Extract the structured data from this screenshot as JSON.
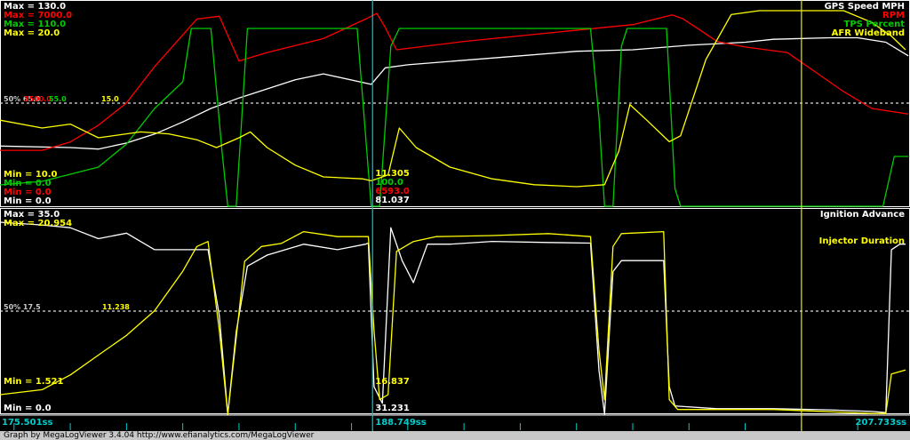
{
  "footer_credit": "Graph by MegaLogViewer 3.4.04 http://www.efianalytics.com/MegaLogViewer",
  "chart_data": [
    {
      "type": "line",
      "panel": "top",
      "max_labels": [
        {
          "text": "Max = 130.0",
          "color": "#ffffff"
        },
        {
          "text": "Max = 7000.0",
          "color": "#ff0000"
        },
        {
          "text": "Max = 110.0",
          "color": "#00cc00"
        },
        {
          "text": "Max = 20.0",
          "color": "#ffff00"
        }
      ],
      "min_labels": [
        {
          "text": "Min = 10.0",
          "color": "#ffff00"
        },
        {
          "text": "Min = 0.0",
          "color": "#00cc00"
        },
        {
          "text": "Min = 0.0",
          "color": "#ff0000"
        },
        {
          "text": "Min = 0.0",
          "color": "#ffffff"
        }
      ],
      "mid_labels": [
        {
          "text": "50%  65.0",
          "color": "#c8c8c8"
        },
        {
          "text": "3500.0",
          "color": "#ff0000"
        },
        {
          "text": "55.0",
          "color": "#00cc00"
        },
        {
          "text": "15.0",
          "color": "#ffff00"
        }
      ],
      "cursor_values": [
        {
          "text": "11.305",
          "color": "#ffff00"
        },
        {
          "text": "100.0",
          "color": "#00cc00"
        },
        {
          "text": "6593.0",
          "color": "#ff0000"
        },
        {
          "text": "81.037",
          "color": "#ffffff"
        }
      ],
      "series": [
        {
          "name": "GPS Speed MPH",
          "color": "#ffffff",
          "min": 0,
          "max": 130,
          "points": [
            [
              175.5,
              40
            ],
            [
              178,
              39
            ],
            [
              179,
              38
            ],
            [
              180,
              42
            ],
            [
              181,
              48
            ],
            [
              182,
              56
            ],
            [
              183,
              65
            ],
            [
              184,
              72
            ],
            [
              185,
              78
            ],
            [
              186,
              84
            ],
            [
              187,
              88
            ],
            [
              188.7,
              81
            ],
            [
              189.2,
              92
            ],
            [
              190,
              94
            ],
            [
              192,
              97
            ],
            [
              194,
              100
            ],
            [
              196,
              103
            ],
            [
              198,
              104
            ],
            [
              200,
              107
            ],
            [
              202,
              109
            ],
            [
              203,
              111
            ],
            [
              205,
              112
            ],
            [
              206,
              112
            ],
            [
              207,
              109
            ],
            [
              207.8,
              100
            ]
          ]
        },
        {
          "name": "RPM",
          "color": "#ff0000",
          "min": 0,
          "max": 7000,
          "points": [
            [
              175.5,
              2000
            ],
            [
              177,
              2000
            ],
            [
              178,
              2300
            ],
            [
              179,
              2900
            ],
            [
              180,
              3700
            ],
            [
              181,
              5000
            ],
            [
              182.5,
              6700
            ],
            [
              183.3,
              6800
            ],
            [
              184,
              5200
            ],
            [
              185,
              5500
            ],
            [
              187,
              6000
            ],
            [
              188.5,
              6700
            ],
            [
              188.9,
              6900
            ],
            [
              189.2,
              6400
            ],
            [
              189.6,
              5600
            ],
            [
              192,
              5900
            ],
            [
              195,
              6200
            ],
            [
              198,
              6500
            ],
            [
              199.4,
              6850
            ],
            [
              199.8,
              6700
            ],
            [
              201,
              5900
            ],
            [
              202,
              5700
            ],
            [
              203.5,
              5500
            ],
            [
              204.5,
              4800
            ],
            [
              205.5,
              4100
            ],
            [
              206.5,
              3500
            ],
            [
              207.8,
              3300
            ]
          ]
        },
        {
          "name": "TPS Percent",
          "color": "#00cc00",
          "min": 0,
          "max": 110,
          "points": [
            [
              175.5,
              12
            ],
            [
              177,
              14
            ],
            [
              178,
              18
            ],
            [
              179,
              22
            ],
            [
              180,
              35
            ],
            [
              181,
              55
            ],
            [
              182,
              70
            ],
            [
              182.3,
              100
            ],
            [
              183,
              100
            ],
            [
              183.4,
              30
            ],
            [
              183.6,
              0
            ],
            [
              183.9,
              0
            ],
            [
              184.3,
              100
            ],
            [
              188.2,
              100
            ],
            [
              188.6,
              20
            ],
            [
              188.7,
              0
            ],
            [
              189,
              0
            ],
            [
              189.4,
              90
            ],
            [
              189.7,
              100
            ],
            [
              196.5,
              100
            ],
            [
              196.8,
              50
            ],
            [
              197,
              0
            ],
            [
              197.3,
              0
            ],
            [
              197.6,
              90
            ],
            [
              197.8,
              100
            ],
            [
              199.2,
              100
            ],
            [
              199.5,
              10
            ],
            [
              199.7,
              0
            ],
            [
              206.9,
              0
            ],
            [
              207.3,
              28
            ],
            [
              207.8,
              28
            ]
          ]
        },
        {
          "name": "AFR Wideband",
          "color": "#ffff00",
          "min": 10,
          "max": 20,
          "points": [
            [
              175.5,
              14.4
            ],
            [
              177,
              14
            ],
            [
              178,
              14.2
            ],
            [
              179,
              13.5
            ],
            [
              180.5,
              13.8
            ],
            [
              181.5,
              13.7
            ],
            [
              182.5,
              13.4
            ],
            [
              183.2,
              13.0
            ],
            [
              184,
              13.5
            ],
            [
              184.4,
              13.8
            ],
            [
              185,
              13.0
            ],
            [
              186,
              12.1
            ],
            [
              187,
              11.5
            ],
            [
              188.4,
              11.4
            ],
            [
              188.7,
              11.3
            ],
            [
              189.3,
              11.6
            ],
            [
              189.7,
              14.0
            ],
            [
              190.3,
              13.0
            ],
            [
              191.5,
              12.0
            ],
            [
              193,
              11.4
            ],
            [
              194.5,
              11.1
            ],
            [
              196,
              11.0
            ],
            [
              197,
              11.1
            ],
            [
              197.5,
              12.8
            ],
            [
              197.9,
              15.2
            ],
            [
              198.5,
              14.4
            ],
            [
              199.3,
              13.3
            ],
            [
              199.7,
              13.6
            ],
            [
              200.6,
              17.5
            ],
            [
              201.5,
              19.8
            ],
            [
              202.5,
              20
            ],
            [
              204,
              20
            ],
            [
              205.5,
              20
            ],
            [
              206.5,
              19.4
            ],
            [
              207.2,
              18.7
            ],
            [
              207.7,
              18.0
            ]
          ]
        }
      ],
      "legend": [
        {
          "text": "GPS Speed MPH",
          "color": "#ffffff"
        },
        {
          "text": "RPM",
          "color": "#ff0000"
        },
        {
          "text": "TPS Percent",
          "color": "#00cc00"
        },
        {
          "text": "AFR Wideband",
          "color": "#ffff00"
        }
      ]
    },
    {
      "type": "line",
      "panel": "bottom",
      "max_labels": [
        {
          "text": "Max = 35.0",
          "color": "#ffffff"
        },
        {
          "text": "Max = 20.954",
          "color": "#ffff00"
        }
      ],
      "min_labels": [
        {
          "text": "Min = 1.521",
          "color": "#ffff00"
        },
        {
          "text": "Min = 0.0",
          "color": "#ffffff"
        }
      ],
      "mid_labels": [
        {
          "text": "50%  17.5",
          "color": "#c8c8c8"
        },
        {
          "text": "11.238",
          "color": "#ffff00"
        }
      ],
      "cursor_values": [
        {
          "text": "16.837",
          "color": "#ffff00"
        },
        {
          "text": "31.231",
          "color": "#ffffff"
        }
      ],
      "series": [
        {
          "name": "Ignition Advance",
          "color": "#ffffff",
          "min": 0,
          "max": 35,
          "points": [
            [
              175.5,
              35
            ],
            [
              177,
              34.5
            ],
            [
              178,
              34
            ],
            [
              179,
              32
            ],
            [
              180,
              33
            ],
            [
              181,
              30
            ],
            [
              182.3,
              30
            ],
            [
              182.9,
              30
            ],
            [
              183.3,
              18
            ],
            [
              183.6,
              0
            ],
            [
              183.9,
              15
            ],
            [
              184.3,
              27
            ],
            [
              185,
              29
            ],
            [
              186.3,
              31
            ],
            [
              187.5,
              30
            ],
            [
              188.5,
              31
            ],
            [
              188.6,
              31.2
            ],
            [
              188.8,
              5
            ],
            [
              189.1,
              2
            ],
            [
              189.4,
              34
            ],
            [
              189.8,
              28
            ],
            [
              190.2,
              24
            ],
            [
              190.7,
              31
            ],
            [
              191.5,
              31
            ],
            [
              193,
              31.5
            ],
            [
              195,
              31.3
            ],
            [
              196.5,
              31.2
            ],
            [
              196.8,
              8
            ],
            [
              197,
              0
            ],
            [
              197.3,
              26
            ],
            [
              197.6,
              28
            ],
            [
              199.1,
              28
            ],
            [
              199.3,
              5
            ],
            [
              199.5,
              1.5
            ],
            [
              201,
              1
            ],
            [
              203,
              1
            ],
            [
              205,
              0.8
            ],
            [
              206.5,
              0.5
            ],
            [
              207,
              0.3
            ],
            [
              207.2,
              30
            ],
            [
              207.5,
              31
            ],
            [
              207.7,
              31
            ]
          ]
        },
        {
          "name": "Injector Duration",
          "color": "#ffff00",
          "min": 1.521,
          "max": 20.954,
          "points": [
            [
              175.5,
              3.5
            ],
            [
              177,
              4
            ],
            [
              178,
              5.5
            ],
            [
              179,
              7.5
            ],
            [
              180,
              9.5
            ],
            [
              181,
              12
            ],
            [
              182,
              16
            ],
            [
              182.5,
              18.5
            ],
            [
              182.9,
              19
            ],
            [
              183.3,
              10
            ],
            [
              183.6,
              1.5
            ],
            [
              184.2,
              17
            ],
            [
              184.8,
              18.5
            ],
            [
              185.5,
              18.8
            ],
            [
              186.3,
              20
            ],
            [
              187.5,
              19.5
            ],
            [
              188.5,
              19.5
            ],
            [
              188.6,
              19.5
            ],
            [
              188.8,
              10
            ],
            [
              189,
              3
            ],
            [
              189.3,
              3.5
            ],
            [
              189.6,
              18
            ],
            [
              190.2,
              19
            ],
            [
              191,
              19.5
            ],
            [
              193,
              19.6
            ],
            [
              195,
              19.8
            ],
            [
              196.5,
              19.5
            ],
            [
              196.8,
              8
            ],
            [
              197,
              3
            ],
            [
              197.3,
              18.5
            ],
            [
              197.6,
              19.8
            ],
            [
              199.1,
              20
            ],
            [
              199.3,
              3
            ],
            [
              199.6,
              2
            ],
            [
              203,
              2
            ],
            [
              206.5,
              1.6
            ],
            [
              207,
              1.6
            ],
            [
              207.2,
              5.6
            ],
            [
              207.7,
              6
            ]
          ]
        }
      ],
      "legend": [
        {
          "text": "Ignition Advance",
          "color": "#ffffff"
        },
        {
          "text": "Injector Duration",
          "color": "#ffff00"
        }
      ]
    }
  ],
  "time_axis": {
    "start": 175.501,
    "end": 207.733,
    "labels": [
      {
        "text": "175.501ss",
        "value": 175.501,
        "color": "#00cccc"
      },
      {
        "text": "188.749ss",
        "value": 188.749,
        "color": "#00cccc"
      },
      {
        "text": "207.733ss",
        "value": 207.733,
        "color": "#00cccc"
      }
    ],
    "cursors": [
      {
        "name": "cyan-cursor",
        "value": 188.749,
        "color": "#00cccc"
      },
      {
        "name": "yellow-cursor",
        "value": 204.0,
        "color": "#e8e800"
      }
    ],
    "tick_spacing_seconds": 2
  }
}
